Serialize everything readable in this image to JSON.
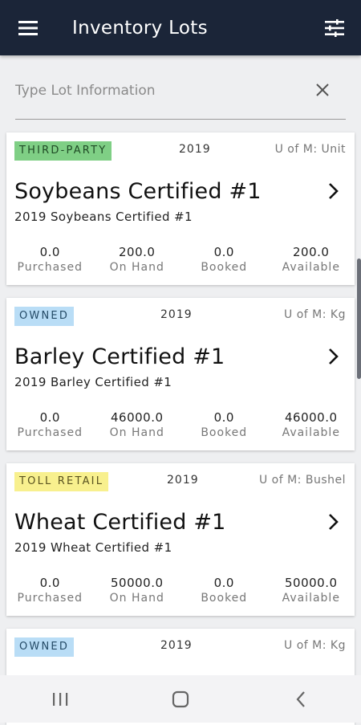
{
  "appbar": {
    "title": "Inventory Lots",
    "menu_icon": "hamburger-menu-icon",
    "filter_icon": "sliders-filter-icon"
  },
  "search": {
    "placeholder": "Type Lot Information",
    "value": "",
    "clear_icon": "close-icon"
  },
  "lots": [
    {
      "badge": "THIRD-PARTY",
      "badge_color": "#7fcf85",
      "year": "2019",
      "uom": "U of M: Unit",
      "name": "Soybeans Certified #1",
      "subtitle": "2019 Soybeans Certified #1",
      "stats": [
        {
          "value": "0.0",
          "label": "Purchased"
        },
        {
          "value": "200.0",
          "label": "On Hand"
        },
        {
          "value": "0.0",
          "label": "Booked"
        },
        {
          "value": "200.0",
          "label": "Available"
        }
      ]
    },
    {
      "badge": "OWNED",
      "badge_color": "#b9ddf6",
      "year": "2019",
      "uom": "U of M: Kg",
      "name": "Barley Certified #1",
      "subtitle": "2019 Barley Certified #1",
      "stats": [
        {
          "value": "0.0",
          "label": "Purchased"
        },
        {
          "value": "46000.0",
          "label": "On Hand"
        },
        {
          "value": "0.0",
          "label": "Booked"
        },
        {
          "value": "46000.0",
          "label": "Available"
        }
      ]
    },
    {
      "badge": "TOLL RETAIL",
      "badge_color": "#f8f08e",
      "year": "2019",
      "uom": "U of M: Bushel",
      "name": "Wheat Certified #1",
      "subtitle": "2019 Wheat Certified #1",
      "stats": [
        {
          "value": "0.0",
          "label": "Purchased"
        },
        {
          "value": "50000.0",
          "label": "On Hand"
        },
        {
          "value": "0.0",
          "label": "Booked"
        },
        {
          "value": "50000.0",
          "label": "Available"
        }
      ]
    },
    {
      "badge": "OWNED",
      "badge_color": "#b9ddf6",
      "year": "2019",
      "uom": "U of M: Kg"
    }
  ],
  "navbar": {
    "recents_icon": "recent-apps-icon",
    "home_icon": "home-icon",
    "back_icon": "back-icon"
  }
}
